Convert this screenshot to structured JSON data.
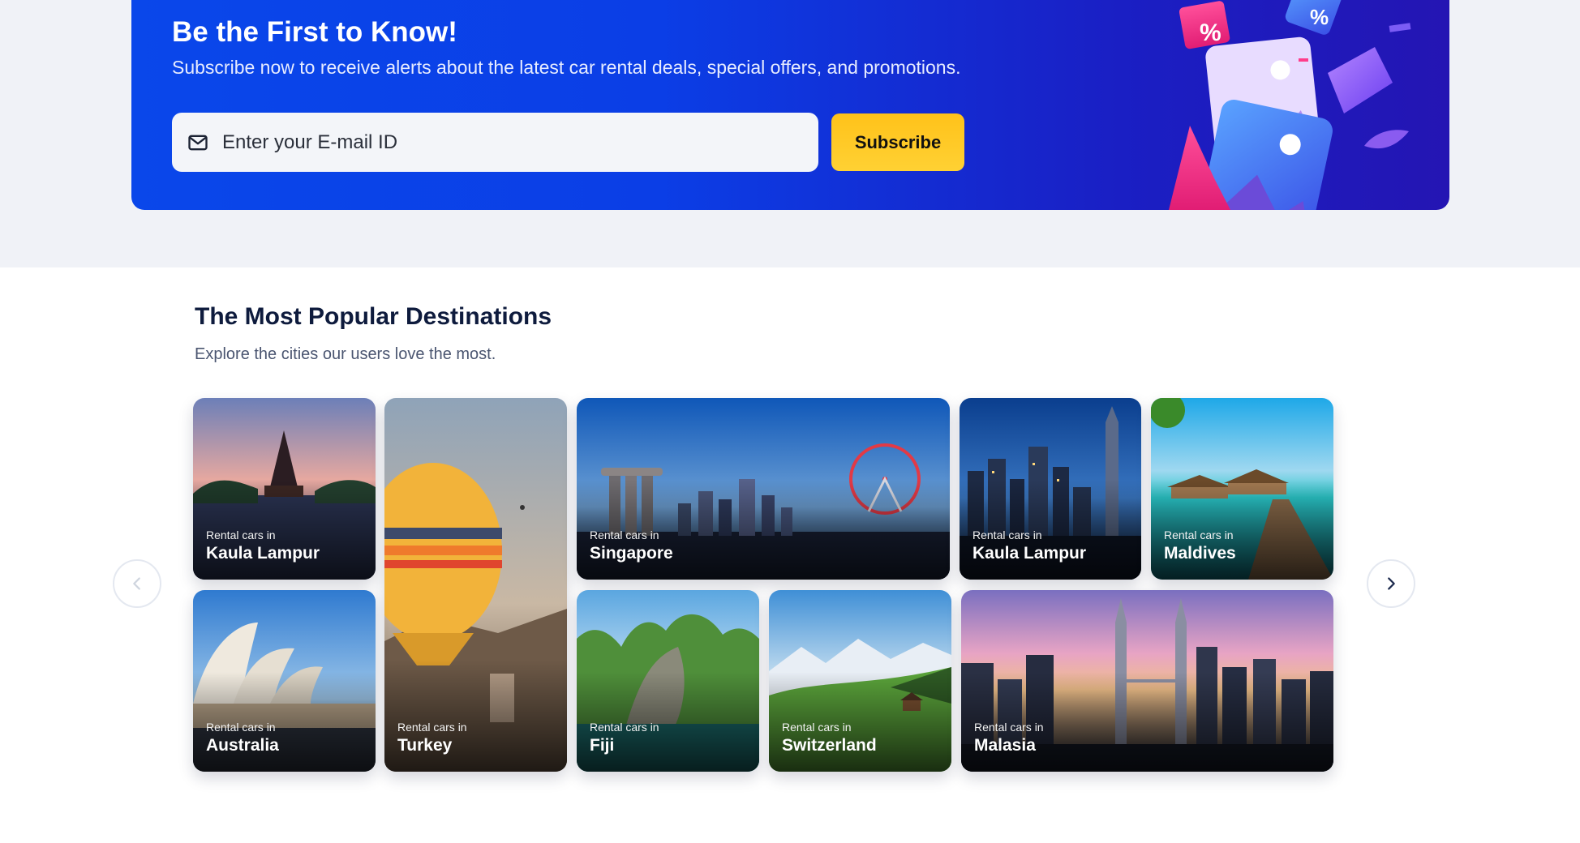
{
  "banner": {
    "title": "Be the First to Know!",
    "subtitle": "Subscribe now to receive alerts about the latest car rental deals, special offers, and promotions.",
    "email_placeholder": "Enter your E-mail ID",
    "subscribe_label": "Subscribe",
    "badge_text": "%"
  },
  "destinations": {
    "title": "The Most Popular Destinations",
    "subtitle": "Explore the cities our users love the most.",
    "prefix": "Rental cars in",
    "cards": [
      {
        "city": "Kaula Lampur",
        "scene": "temple"
      },
      {
        "city": "Turkey",
        "scene": "balloon"
      },
      {
        "city": "Singapore",
        "scene": "skyline-wheel"
      },
      {
        "city": "Kaula Lampur",
        "scene": "city-night"
      },
      {
        "city": "Maldives",
        "scene": "water-villas"
      },
      {
        "city": "Australia",
        "scene": "opera-house"
      },
      {
        "city": "Fiji",
        "scene": "cliffs"
      },
      {
        "city": "Switzerland",
        "scene": "alps"
      },
      {
        "city": "Malasia",
        "scene": "twin-towers"
      }
    ]
  },
  "nav": {
    "prev": "chevron-left-icon",
    "next": "chevron-right-icon"
  },
  "colors": {
    "banner_start": "#0a47ea",
    "banner_end": "#2415b3",
    "subscribe": "#ffc21a",
    "title": "#0e1b3d"
  }
}
